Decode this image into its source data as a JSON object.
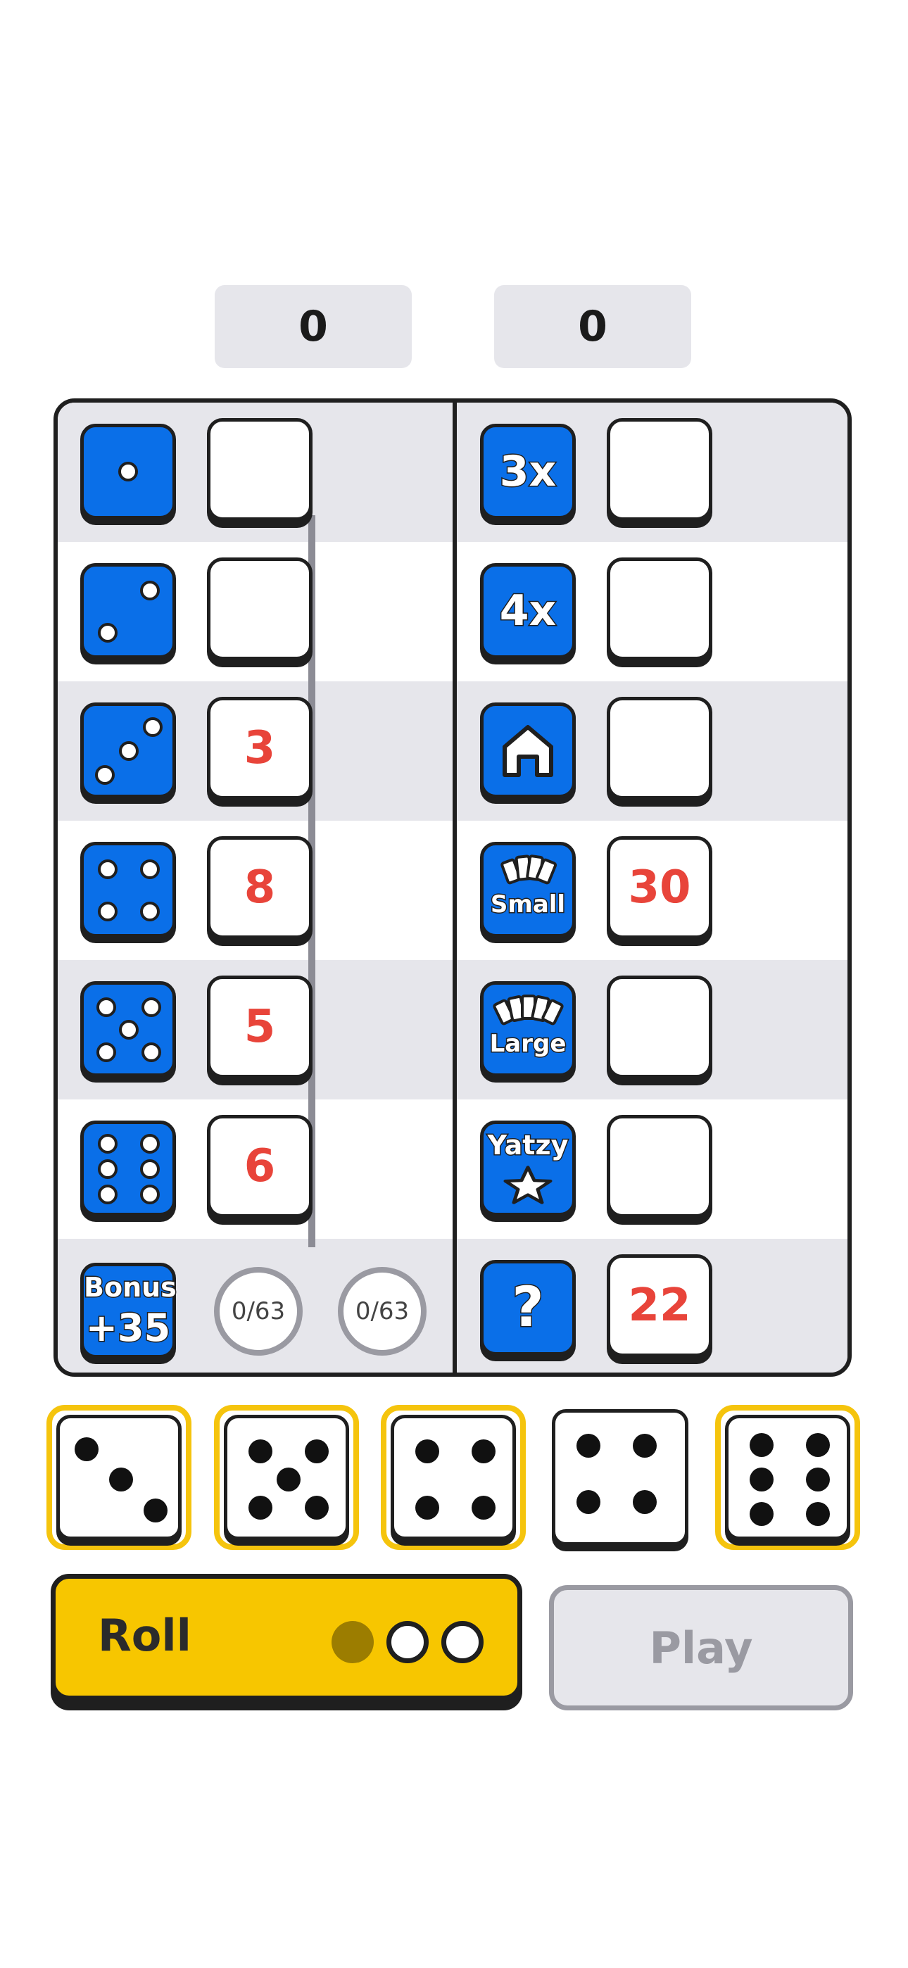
{
  "totals": {
    "left": "0",
    "right": "0"
  },
  "upper_section": {
    "categories": [
      "ones",
      "twos",
      "threes",
      "fours",
      "fives",
      "sixes"
    ],
    "scores": [
      "",
      "",
      "3",
      "8",
      "5",
      "6"
    ],
    "bonus": {
      "label_top": "Bonus",
      "label_bottom": "+35",
      "progress_1": "0/63",
      "progress_2": "0/63"
    }
  },
  "lower_section": {
    "categories": [
      {
        "name": "three-of-a-kind",
        "label": "3x",
        "score": ""
      },
      {
        "name": "four-of-a-kind",
        "label": "4x",
        "score": ""
      },
      {
        "name": "full-house",
        "label": "",
        "score": ""
      },
      {
        "name": "small-straight",
        "label": "Small",
        "score": "30"
      },
      {
        "name": "large-straight",
        "label": "Large",
        "score": ""
      },
      {
        "name": "yatzy",
        "label": "Yatzy",
        "score": ""
      },
      {
        "name": "chance",
        "label": "?",
        "score": "22"
      }
    ]
  },
  "dice": [
    {
      "value": 3,
      "held": true
    },
    {
      "value": 5,
      "held": true
    },
    {
      "value": 4,
      "held": true
    },
    {
      "value": 4,
      "held": false
    },
    {
      "value": 6,
      "held": true
    }
  ],
  "controls": {
    "roll_label": "Roll",
    "rolls_used": 1,
    "rolls_total": 3,
    "play_label": "Play"
  },
  "colors": {
    "category_blue": "#0a6fe8",
    "score_red": "#e8443a",
    "roll_yellow": "#f7c600",
    "held_border": "#f5c40d"
  }
}
